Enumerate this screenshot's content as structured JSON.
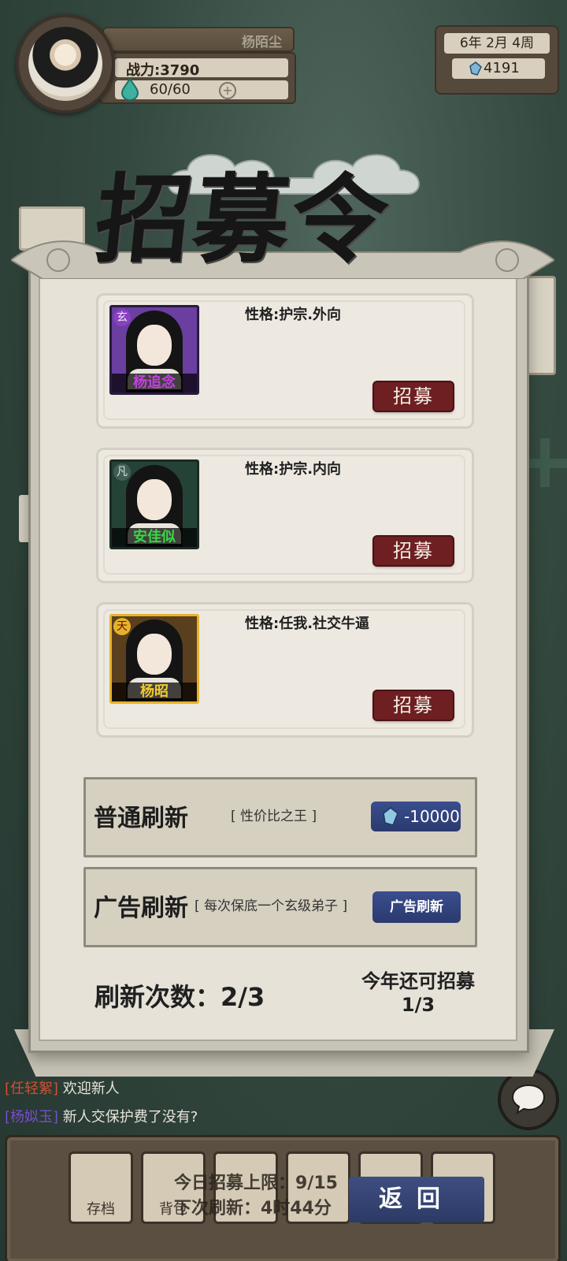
{
  "player": {
    "name": "杨陌尘",
    "power_label": "战力:3790",
    "stamina": "60/60",
    "plus": "+"
  },
  "calendar": {
    "date": "6年  2月  4周",
    "gems": "4191"
  },
  "dialog": {
    "title": "招募令",
    "recruit_label": "招募",
    "candidates": [
      {
        "name": "杨追念",
        "rank": "玄",
        "personality": "性格:护宗.外向",
        "rank_color": "#8a3fc4",
        "name_color": "#c240e0"
      },
      {
        "name": "安佳似",
        "rank": "凡",
        "personality": "性格:护宗.内向",
        "rank_color": "#3f5f56",
        "name_color": "#39d646"
      },
      {
        "name": "杨昭",
        "rank": "天",
        "personality": "性格:任我.社交牛逼",
        "rank_color": "#e7b22a",
        "name_color": "#f2c92b"
      }
    ],
    "normal_refresh": {
      "title": "普通刷新",
      "desc": "[ 性价比之王 ]",
      "cost": "-10000"
    },
    "ad_refresh": {
      "title": "广告刷新",
      "desc": "[ 每次保底一个玄级弟子 ]",
      "button": "广告刷新"
    },
    "refresh_count": "刷新次数：2/3",
    "year_remaining": "今年还可招募1/3"
  },
  "chat": {
    "lines": [
      {
        "who": "[任轻絮]",
        "text": "欢迎新人",
        "who_class": "who1"
      },
      {
        "who": "[杨姒玉]",
        "text": "新人交保护费了没有?",
        "who_class": "who2"
      }
    ]
  },
  "bottom": {
    "tabs": [
      "存档",
      "背包",
      "",
      "",
      "",
      ""
    ],
    "limit_text": "今日招募上限：9/15",
    "next_text": "下次刷新：4时44分",
    "return_label": "返回"
  }
}
